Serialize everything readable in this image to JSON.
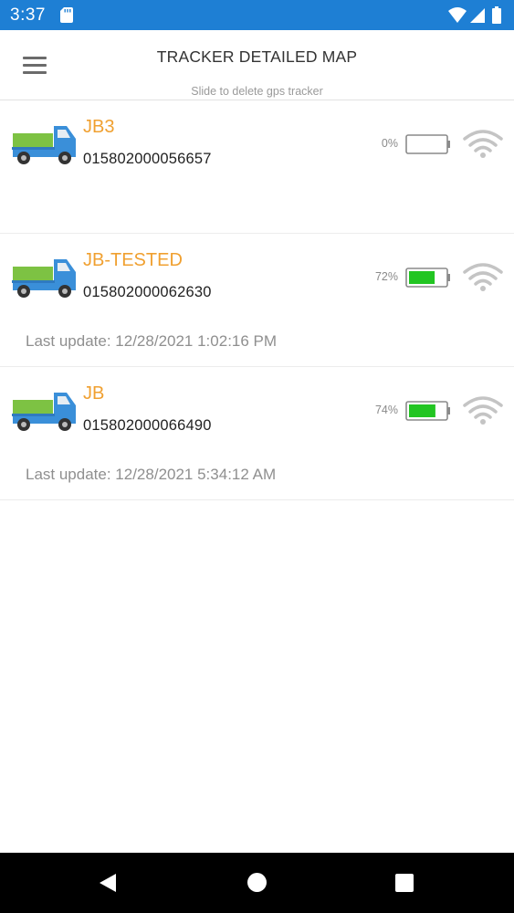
{
  "status_bar": {
    "time": "3:37",
    "background_color": "#1e7fd4",
    "icons": [
      "sd-card-icon",
      "wifi-signal-icon",
      "cell-signal-icon",
      "battery-icon"
    ]
  },
  "header": {
    "title": "TRACKER DETAILED MAP",
    "subtitle": "Slide to delete gps tracker",
    "menu_icon": "hamburger-menu-icon"
  },
  "trackers": [
    {
      "name": "JB3",
      "id": "015802000056657",
      "battery_label": "0%",
      "battery_level": 0,
      "last_update": ""
    },
    {
      "name": "JB-TESTED",
      "id": "015802000062630",
      "battery_label": "72%",
      "battery_level": 0.72,
      "last_update": "Last update: 12/28/2021 1:02:16 PM"
    },
    {
      "name": "JB",
      "id": "015802000066490",
      "battery_label": "74%",
      "battery_level": 0.74,
      "last_update": "Last update: 12/28/2021 5:34:12 AM"
    }
  ],
  "colors": {
    "name_color": "#f0a030",
    "battery_fill": "#22c522",
    "wifi_gray": "#c4c4c4"
  },
  "nav_bar": {
    "icons": [
      "back-icon",
      "home-icon",
      "recent-apps-icon"
    ]
  }
}
